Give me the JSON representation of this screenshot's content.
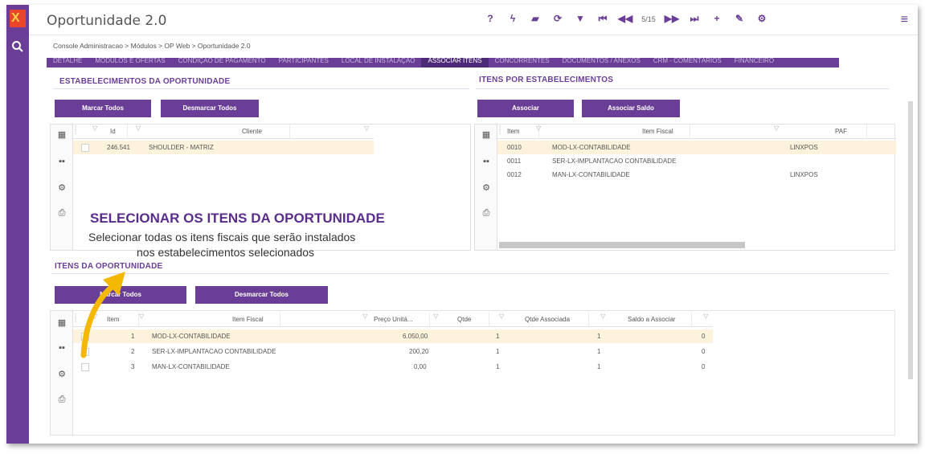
{
  "app": {
    "title": "Oportunidade 2.0",
    "logo_glyph": "X"
  },
  "toolbar": {
    "help": "?",
    "flash": "ϟ",
    "eraser": "▰",
    "refresh": "⟳",
    "filter": "▼",
    "first": "⏮",
    "prev": "◀◀",
    "record_count": "5/15",
    "next": "▶▶",
    "last": "⏭",
    "add": "+",
    "edit": "✎",
    "settings": "⚙",
    "menu": "≡"
  },
  "breadcrumb": "Console Administracao  >  Módulos  >  OP Web  >  Oportunidade 2.0",
  "tabs": [
    {
      "label": "DETALHE",
      "active": false
    },
    {
      "label": "MÓDULOS E OFERTAS",
      "active": false
    },
    {
      "label": "CONDIÇÃO DE PAGAMENTO",
      "active": false
    },
    {
      "label": "PARTICIPANTES",
      "active": false
    },
    {
      "label": "LOCAL DE INSTALAÇÃO",
      "active": false
    },
    {
      "label": "ASSOCIAR ITENS",
      "active": true
    },
    {
      "label": "CONCORRENTES",
      "active": false
    },
    {
      "label": "DOCUMENTOS / ANEXOS",
      "active": false
    },
    {
      "label": "CRM - COMENTÁRIOS",
      "active": false
    },
    {
      "label": "FINANCEIRO",
      "active": false
    }
  ],
  "estab": {
    "title": "ESTABELECIMENTOS  DA OPORTUNIDADE",
    "mark_all": "Marcar Todos",
    "unmark_all": "Desmarcar Todos",
    "columns": [
      "Id",
      "Cliente"
    ],
    "rows": [
      {
        "id": "246.541",
        "cliente": "SHOULDER - MATRIZ"
      }
    ]
  },
  "itens_estab": {
    "title": "ITENS  POR ESTABELECIMENTOS",
    "associate": "Associar",
    "associate_balance": "Associar Saldo",
    "columns": [
      "Item",
      "Item Fiscal",
      "PAF"
    ],
    "rows": [
      {
        "item": "0010",
        "fiscal": "MOD-LX-CONTABILIDADE",
        "paf": "LINXPOS"
      },
      {
        "item": "0011",
        "fiscal": "SER-LX-IMPLANTACAO CONTABILIDADE",
        "paf": ""
      },
      {
        "item": "0012",
        "fiscal": "MAN-LX-CONTABILIDADE",
        "paf": "LINXPOS"
      }
    ]
  },
  "itens_op": {
    "title": "ITENS DA OPORTUNIDADE",
    "mark_all": "Marcar Todos",
    "unmark_all": "Desmarcar Todos",
    "columns": [
      "Item",
      "Item Fiscal",
      "Preço Unitá...",
      "Qtde",
      "Qtde Associada",
      "Saldo a Associar"
    ],
    "rows": [
      {
        "item": "1",
        "fiscal": "MOD-LX-CONTABILIDADE",
        "preco": "6.050,00",
        "qtde": "1",
        "assoc": "1",
        "saldo": "0"
      },
      {
        "item": "2",
        "fiscal": "SER-LX-IMPLANTACAO CONTABILIDADE",
        "preco": "200,20",
        "qtde": "1",
        "assoc": "1",
        "saldo": "0"
      },
      {
        "item": "3",
        "fiscal": "MAN-LX-CONTABILIDADE",
        "preco": "0,00",
        "qtde": "1",
        "assoc": "1",
        "saldo": "0"
      }
    ]
  },
  "annotation": {
    "title": "SELECIONAR OS ITENS DA OPORTUNIDADE",
    "line1": "Selecionar todas os itens fiscais que serão instalados",
    "line2": "nos estabelecimentos selecionados"
  },
  "colors": {
    "brand": "#6a3e96",
    "selected_row": "#fdf3dc",
    "arrow": "#f5b800"
  }
}
